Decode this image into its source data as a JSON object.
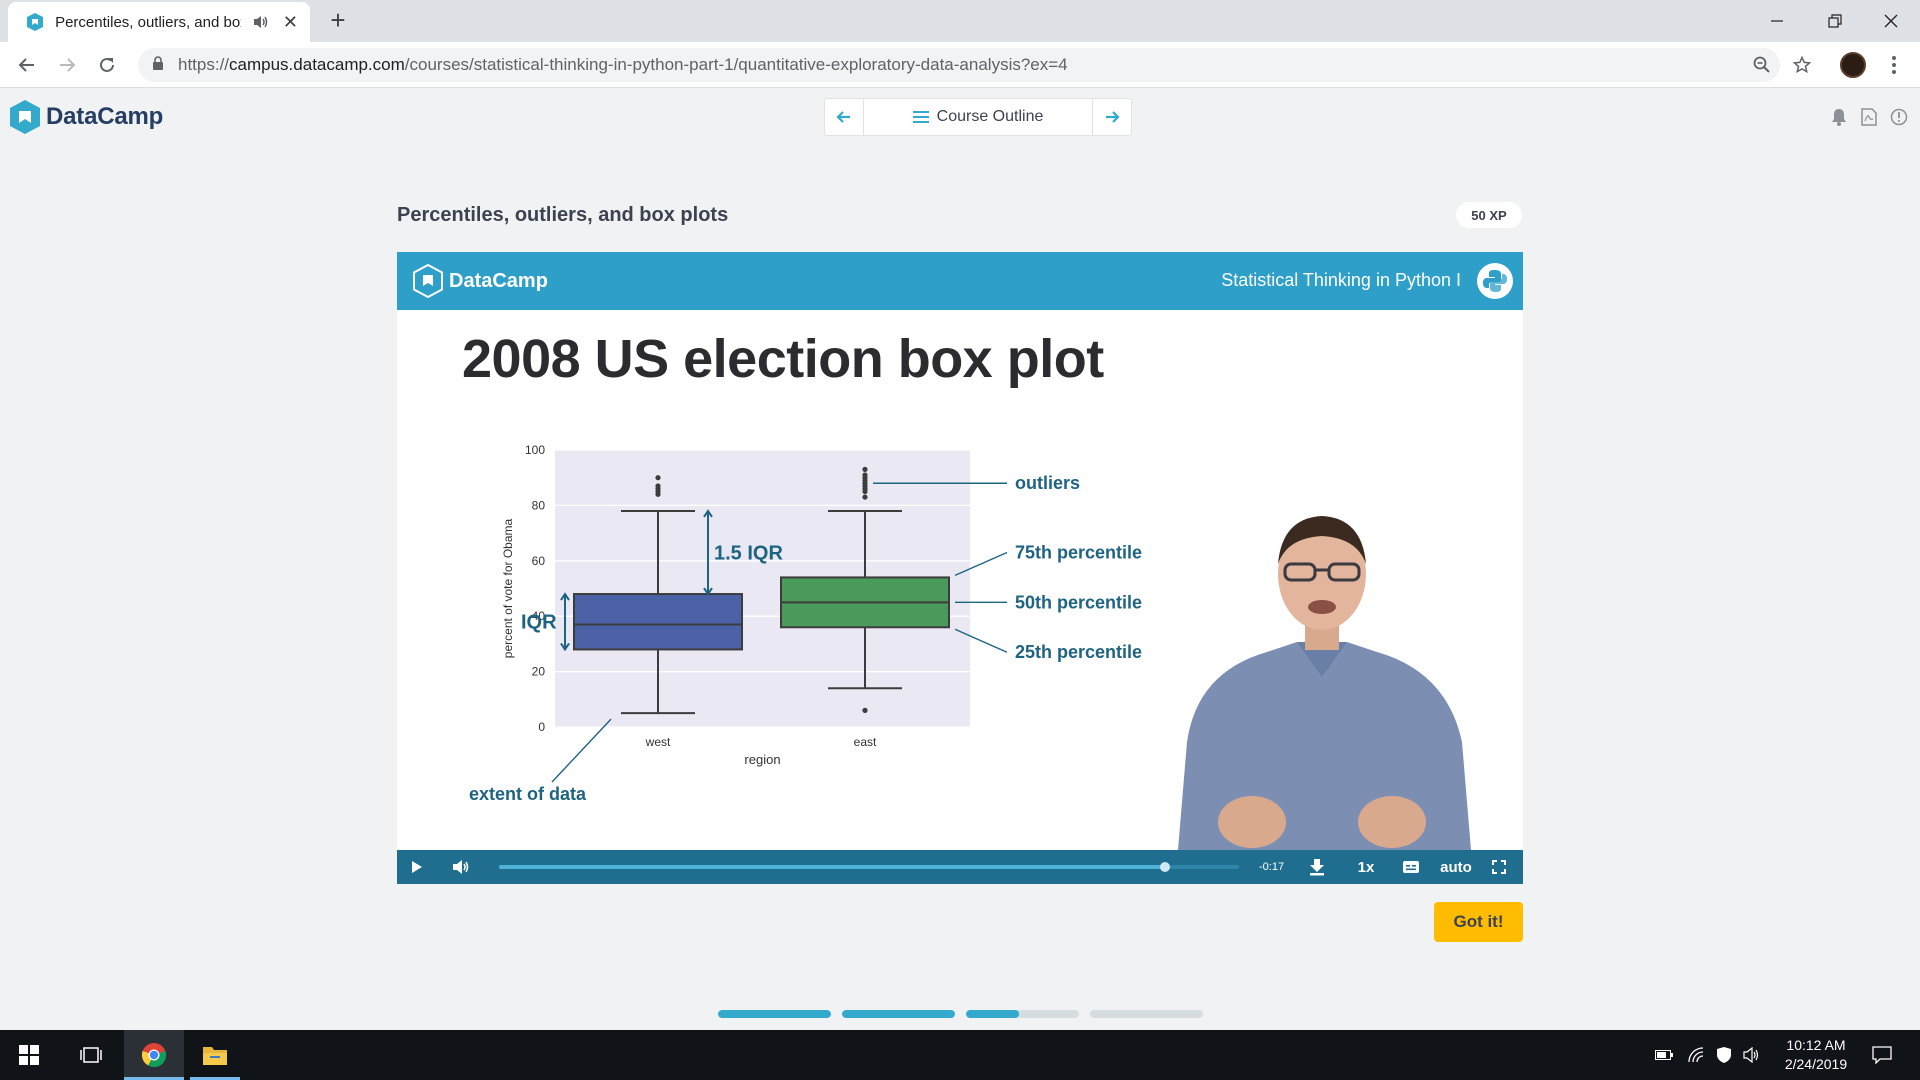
{
  "browser": {
    "tab_title": "Percentiles, outliers, and box plots - DataCamp",
    "url_scheme": "https://",
    "url_host": "campus.datacamp.com",
    "url_path": "/courses/statistical-thinking-in-python-part-1/quantitative-exploratory-data-analysis?ex=4"
  },
  "header": {
    "logo_text": "DataCamp",
    "course_outline_label": "Course Outline"
  },
  "exercise": {
    "title": "Percentiles, outliers, and box plots",
    "xp": "50 XP",
    "got_it_label": "Got it!"
  },
  "slide": {
    "brand": "DataCamp",
    "course_name": "Statistical Thinking in Python I",
    "heading": "2008 US election box plot",
    "annotations": {
      "outliers": "outliers",
      "p75": "75th percentile",
      "p50": "50th percentile",
      "p25": "25th percentile",
      "iqr": "IQR",
      "iqr15": "1.5 IQR",
      "extent": "extent of data"
    }
  },
  "chart_data": {
    "type": "box",
    "categories": [
      "west",
      "east"
    ],
    "xlabel": "region",
    "ylabel": "percent of vote for Obama",
    "ylim": [
      0,
      100
    ],
    "yticks": [
      0,
      20,
      40,
      60,
      80,
      100
    ],
    "boxes": [
      {
        "name": "west",
        "whisker_low": 5,
        "q1": 28,
        "median": 37,
        "q3": 48,
        "whisker_high": 78,
        "outliers": [
          84,
          85,
          86,
          87,
          90
        ],
        "color": "#4c62a6"
      },
      {
        "name": "east",
        "whisker_low": 14,
        "q1": 36,
        "median": 45,
        "q3": 54,
        "whisker_high": 78,
        "outliers": [
          6,
          83,
          85,
          86,
          87,
          88,
          89,
          90,
          91,
          93
        ],
        "color": "#4a9a5b"
      }
    ]
  },
  "player": {
    "time_remaining": "-0:17",
    "progress": 0.9,
    "speed": "1x",
    "quality": "auto"
  },
  "exercise_steps": [
    {
      "progress": 1.0
    },
    {
      "progress": 1.0
    },
    {
      "progress": 0.47
    },
    {
      "progress": 0.0
    }
  ],
  "taskbar": {
    "time": "10:12 AM",
    "date": "2/24/2019"
  },
  "colors": {
    "datacamp_blue": "#33aacc",
    "banner": "#2d9fc8",
    "annotation_text": "#1e6482",
    "got_it": "#ffbc00"
  }
}
